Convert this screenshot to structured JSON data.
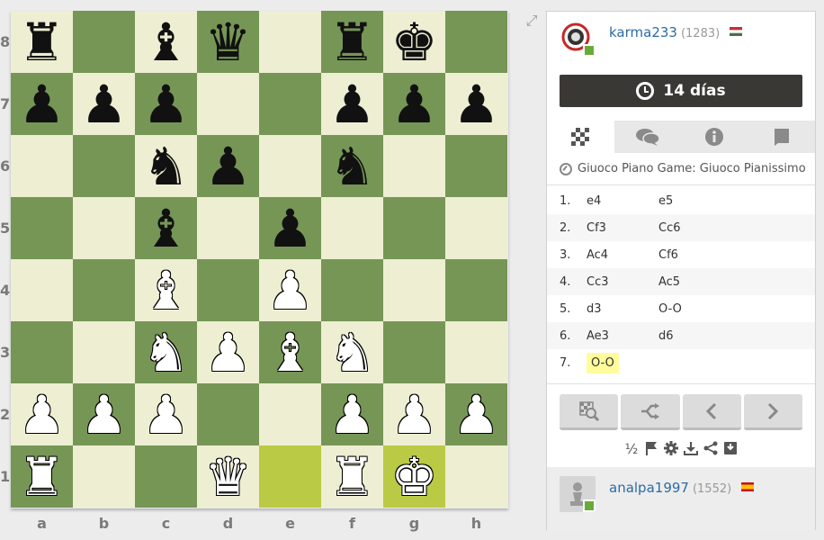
{
  "board": {
    "ranks": [
      "8",
      "7",
      "6",
      "5",
      "4",
      "3",
      "2",
      "1"
    ],
    "files": [
      "a",
      "b",
      "c",
      "d",
      "e",
      "f",
      "g",
      "h"
    ],
    "rows": [
      [
        "bR",
        "",
        "bB",
        "bQ",
        "",
        "bR",
        "bK",
        ""
      ],
      [
        "bP",
        "bP",
        "bP",
        "",
        "",
        "bP",
        "bP",
        "bP"
      ],
      [
        "",
        "",
        "bN",
        "bP",
        "",
        "bN",
        "",
        ""
      ],
      [
        "",
        "",
        "bB",
        "",
        "bP",
        "",
        "",
        ""
      ],
      [
        "",
        "",
        "wB",
        "",
        "wP",
        "",
        "",
        ""
      ],
      [
        "",
        "",
        "wN",
        "wP",
        "wB",
        "wN",
        "",
        ""
      ],
      [
        "wP",
        "wP",
        "wP",
        "",
        "",
        "wP",
        "wP",
        "wP"
      ],
      [
        "wR",
        "",
        "",
        "wQ",
        "hl",
        "wR",
        "wK",
        ""
      ]
    ],
    "highlight_squares": [
      "e1",
      "g1"
    ],
    "colors": {
      "light": "#eeeed2",
      "dark": "#769656",
      "highlight": "#baca44"
    }
  },
  "top_player": {
    "name": "karma233",
    "rating": "(1283)",
    "flag": "hungary-flag"
  },
  "clock": {
    "label": "14 días"
  },
  "tabs": [
    {
      "name": "board-tab",
      "icon": "checkerboard-icon"
    },
    {
      "name": "chat-tab",
      "icon": "chat-icon"
    },
    {
      "name": "info-tab",
      "icon": "info-icon"
    },
    {
      "name": "notes-tab",
      "icon": "book-icon"
    }
  ],
  "opening": "Giuoco Piano Game: Giuoco Pianissimo",
  "moves": [
    {
      "n": "1.",
      "w": "e4",
      "b": "e5"
    },
    {
      "n": "2.",
      "w": "Cf3",
      "b": "Cc6"
    },
    {
      "n": "3.",
      "w": "Ac4",
      "b": "Cf6"
    },
    {
      "n": "4.",
      "w": "Cc3",
      "b": "Ac5"
    },
    {
      "n": "5.",
      "w": "d3",
      "b": "O-O"
    },
    {
      "n": "6.",
      "w": "Ae3",
      "b": "d6"
    },
    {
      "n": "7.",
      "w": "O-O",
      "b": ""
    }
  ],
  "nav_icons": [
    "analysis-icon",
    "flip-icon",
    "prev-icon",
    "next-icon"
  ],
  "tool_icons": {
    "draw_label": "½"
  },
  "bottom_player": {
    "name": "analpa1997",
    "rating": "(1552)",
    "flag": "spain-flag"
  }
}
